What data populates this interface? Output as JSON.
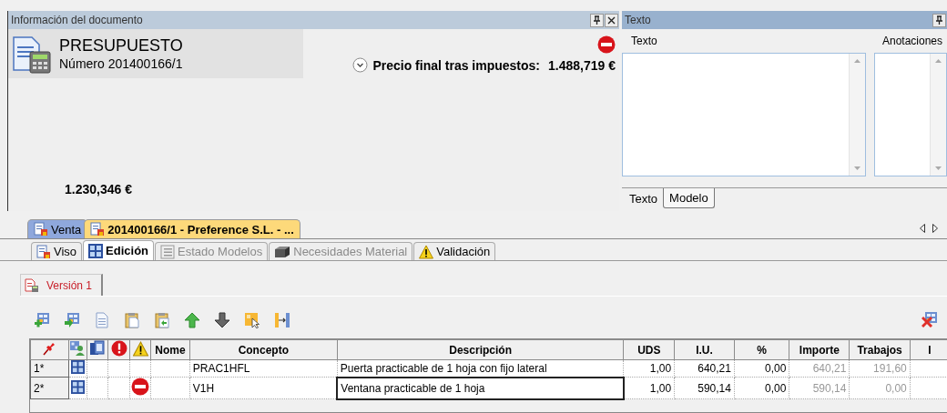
{
  "document_panel": {
    "title": "Información del documento",
    "doc_type": "PRESUPUESTO",
    "number": "Número 201400166/1",
    "blocked": true,
    "final_price_label": "Precio final tras impuestos:",
    "final_price": "1.488,719 €",
    "amount": "1.230,346 €"
  },
  "text_panel": {
    "title": "Texto",
    "fields": [
      {
        "label": "Texto"
      },
      {
        "label": "Anotaciones"
      }
    ],
    "tabs": [
      {
        "label": "Texto",
        "selected": true
      },
      {
        "label": "Modelo",
        "selected": false
      }
    ]
  },
  "doc_tabs": [
    {
      "label": "Venta",
      "selected": false
    },
    {
      "label": "201400166/1 - Preference S.L. - ...",
      "selected": true
    }
  ],
  "sub_tabs": [
    {
      "label": "Viso",
      "kind": "viewer",
      "selected": false,
      "disabled": false
    },
    {
      "label": "Edición",
      "kind": "grid",
      "selected": true,
      "disabled": false
    },
    {
      "label": "Estado Modelos",
      "kind": "list",
      "selected": false,
      "disabled": true
    },
    {
      "label": "Necesidades Material",
      "kind": "box",
      "selected": false,
      "disabled": true
    },
    {
      "label": "Validación",
      "kind": "warning",
      "selected": false,
      "disabled": false
    }
  ],
  "version_tab": {
    "label": "Versión 1",
    "selected": true
  },
  "toolbar": [
    {
      "kind": "add"
    },
    {
      "kind": "insert"
    },
    {
      "kind": "copy"
    },
    {
      "kind": "paste"
    },
    {
      "kind": "pastespecial"
    },
    {
      "kind": "up"
    },
    {
      "kind": "down"
    },
    {
      "kind": "select"
    },
    {
      "kind": "split"
    }
  ],
  "toolbar_right": [
    {
      "kind": "delete"
    }
  ],
  "table": {
    "columns": [
      {
        "kind": "pin"
      },
      {
        "kind": "grid"
      },
      {
        "kind": "copy"
      },
      {
        "kind": "error"
      },
      {
        "kind": "warning"
      },
      {
        "kind": "text",
        "label": "Nome"
      },
      {
        "kind": "text",
        "label": "Concepto"
      },
      {
        "kind": "text",
        "label": "Descripción"
      },
      {
        "kind": "number",
        "label": "UDS"
      },
      {
        "kind": "number",
        "label": "I.U."
      },
      {
        "kind": "number",
        "label": "%"
      },
      {
        "kind": "muted",
        "label": "Importe"
      },
      {
        "kind": "muted",
        "label": "Trabajos"
      },
      {
        "kind": "number",
        "label": "I"
      }
    ],
    "rows": [
      {
        "blocked": false,
        "selected": false,
        "cells": [
          "1*",
          "",
          "",
          "",
          "",
          "",
          "PRAC1HFL",
          "Puerta practicable de 1 hoja con fijo lateral",
          "1,00",
          "640,21",
          "0,00",
          "640,21",
          "191,60",
          ""
        ]
      },
      {
        "blocked": true,
        "selected": true,
        "cells": [
          "2*",
          "",
          "",
          "",
          "",
          "",
          "V1H",
          "Ventana practicable de 1 hoja",
          "1,00",
          "590,14",
          "0,00",
          "590,14",
          "0,00",
          ""
        ]
      }
    ]
  }
}
